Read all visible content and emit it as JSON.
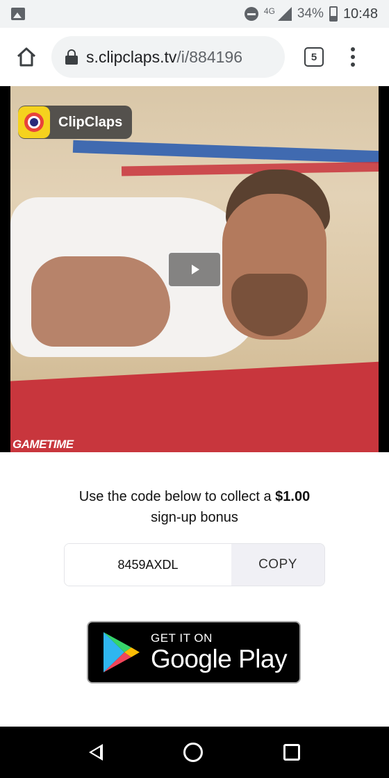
{
  "status_bar": {
    "network": "4G",
    "battery_percent": "34%",
    "battery_level": 0.34,
    "time": "10:48"
  },
  "browser": {
    "url_host": "s.clipclaps.tv",
    "url_path": "/i/884196",
    "tab_count": "5"
  },
  "video": {
    "badge_label": "ClipClaps",
    "watermark": "GAMETIME"
  },
  "promo": {
    "text_before": "Use the code below to collect a ",
    "amount": "$1.00",
    "text_after": " sign-up bonus"
  },
  "code": {
    "value": "8459AXDL",
    "copy_label": "COPY"
  },
  "store_badge": {
    "small_text": "GET IT ON",
    "big_text": "Google Play"
  },
  "colors": {
    "badge_yellow": "#f5d21e",
    "copy_bg": "#f0f0f5"
  }
}
